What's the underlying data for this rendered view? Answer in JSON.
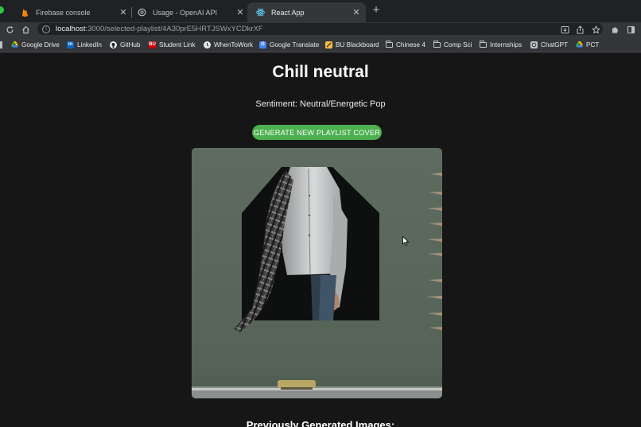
{
  "browser": {
    "tabs": [
      {
        "title": "Firebase console",
        "icon": "firebase-icon"
      },
      {
        "title": "Usage - OpenAI API",
        "icon": "openai-icon"
      },
      {
        "title": "React App",
        "icon": "react-icon",
        "active": true
      }
    ],
    "new_tab_glyph": "+",
    "close_glyph": "✕",
    "url_host": "localhost",
    "url_path": ":3000/selected-playlist/4A30prE5HRTJSWxYCDkrXF",
    "bookmarks": [
      {
        "label": "Google Drive",
        "icon": "google-drive-icon"
      },
      {
        "label": "LinkedIn",
        "icon": "linkedin-icon"
      },
      {
        "label": "GitHub",
        "icon": "github-icon"
      },
      {
        "label": "Student Link",
        "icon": "bu-icon"
      },
      {
        "label": "WhenToWork",
        "icon": "whentowork-icon"
      },
      {
        "label": "Google Translate",
        "icon": "google-translate-icon"
      },
      {
        "label": "BU Blackboard",
        "icon": "blackboard-icon"
      },
      {
        "label": "Chinese 4",
        "icon": "folder-icon"
      },
      {
        "label": "Comp Sci",
        "icon": "folder-icon"
      },
      {
        "label": "Internships",
        "icon": "folder-icon"
      },
      {
        "label": "ChatGPT",
        "icon": "chatgpt-icon"
      },
      {
        "label": "PCT",
        "icon": "google-drive-icon"
      }
    ]
  },
  "page": {
    "title": "Chill neutral",
    "sentiment": "Sentiment: Neutral/Energetic Pop",
    "generate_button": "GENERATE NEW PLAYLIST COVER",
    "previous_heading": "Previously Generated Images:"
  },
  "colors": {
    "accent_green": "#4caf50",
    "page_bg": "#161616",
    "cover_bg": "#5b6a5d"
  }
}
